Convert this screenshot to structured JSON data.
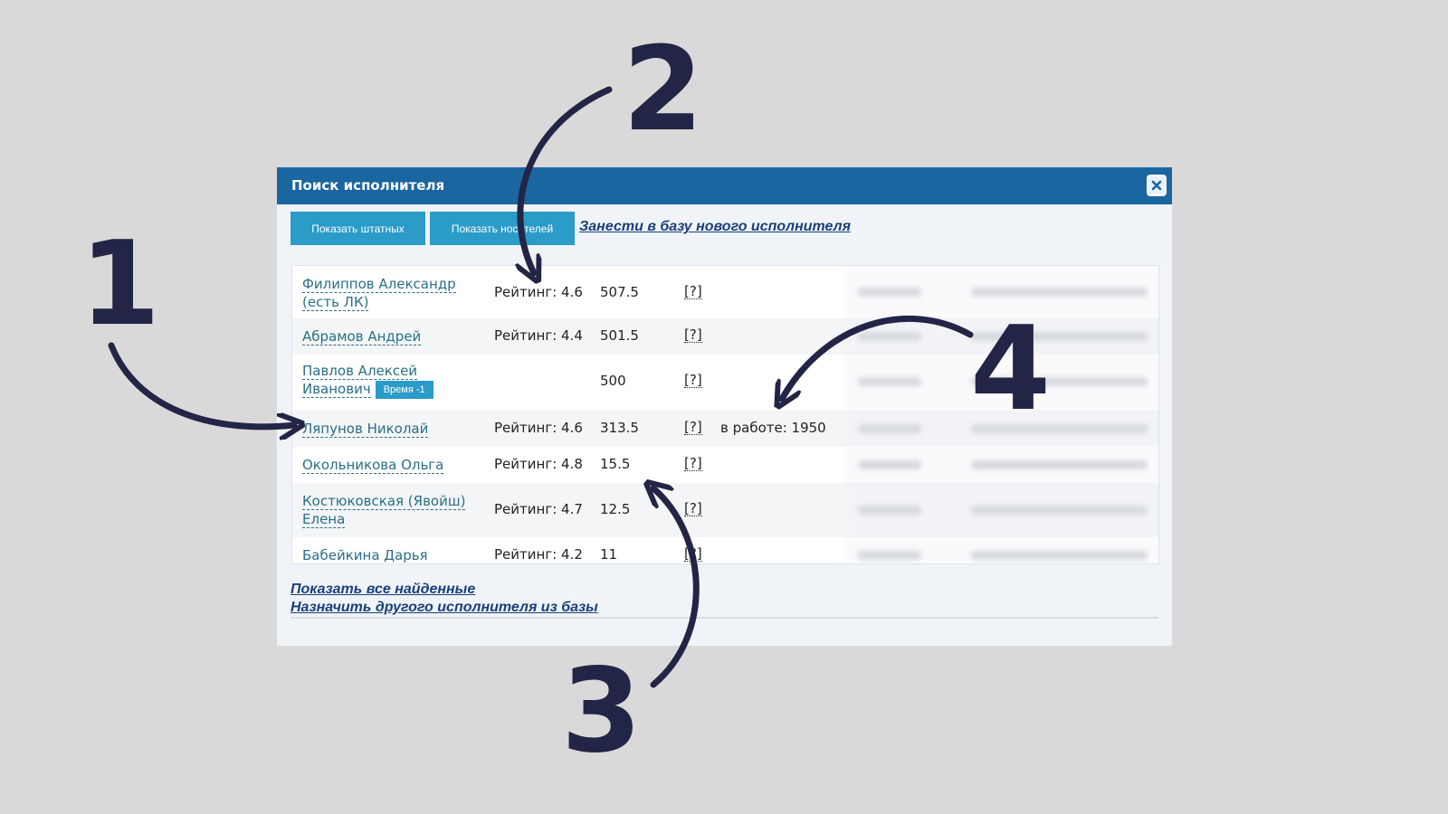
{
  "dialog": {
    "title": "Поиск исполнителя",
    "toolbar": {
      "show_staff_label": "Показать штатных",
      "show_carriers_label": "Показать носителей",
      "add_new_link": "Занести в базу нового исполнителя"
    },
    "rows": [
      {
        "name_line1": "Филиппов Александр",
        "name_line2": "(есть ЛК)",
        "rating": "Рейтинг: 4.6",
        "score": "507.5",
        "q": "[?]",
        "work": "",
        "badge": ""
      },
      {
        "name_line1": "Абрамов Андрей",
        "name_line2": "",
        "rating": "Рейтинг: 4.4",
        "score": "501.5",
        "q": "[?]",
        "work": "",
        "badge": ""
      },
      {
        "name_line1": "Павлов Алексей",
        "name_line2": "Иванович",
        "rating": "",
        "score": "500",
        "q": "[?]",
        "work": "",
        "badge": "Время -1"
      },
      {
        "name_line1": "Ляпунов Николай",
        "name_line2": "",
        "rating": "Рейтинг: 4.6",
        "score": "313.5",
        "q": "[?]",
        "work": "в работе: 1950",
        "badge": ""
      },
      {
        "name_line1": "Окольникова Ольга",
        "name_line2": "",
        "rating": "Рейтинг: 4.8",
        "score": "15.5",
        "q": "[?]",
        "work": "",
        "badge": ""
      },
      {
        "name_line1": "Костюковская (Явойш)",
        "name_line2": "Елена",
        "rating": "Рейтинг: 4.7",
        "score": "12.5",
        "q": "[?]",
        "work": "",
        "badge": ""
      },
      {
        "name_line1": "Бабейкина Дарья",
        "name_line2": "",
        "rating": "Рейтинг: 4.2",
        "score": "11",
        "q": "[?]",
        "work": "",
        "badge": ""
      }
    ],
    "footer": {
      "show_all_link": "Показать все найденные",
      "assign_other_link": "Назначить другого исполнителя из базы"
    }
  },
  "annotations": {
    "label_1": "1",
    "label_2": "2",
    "label_3": "3",
    "label_4": "4",
    "color": "#232546"
  }
}
